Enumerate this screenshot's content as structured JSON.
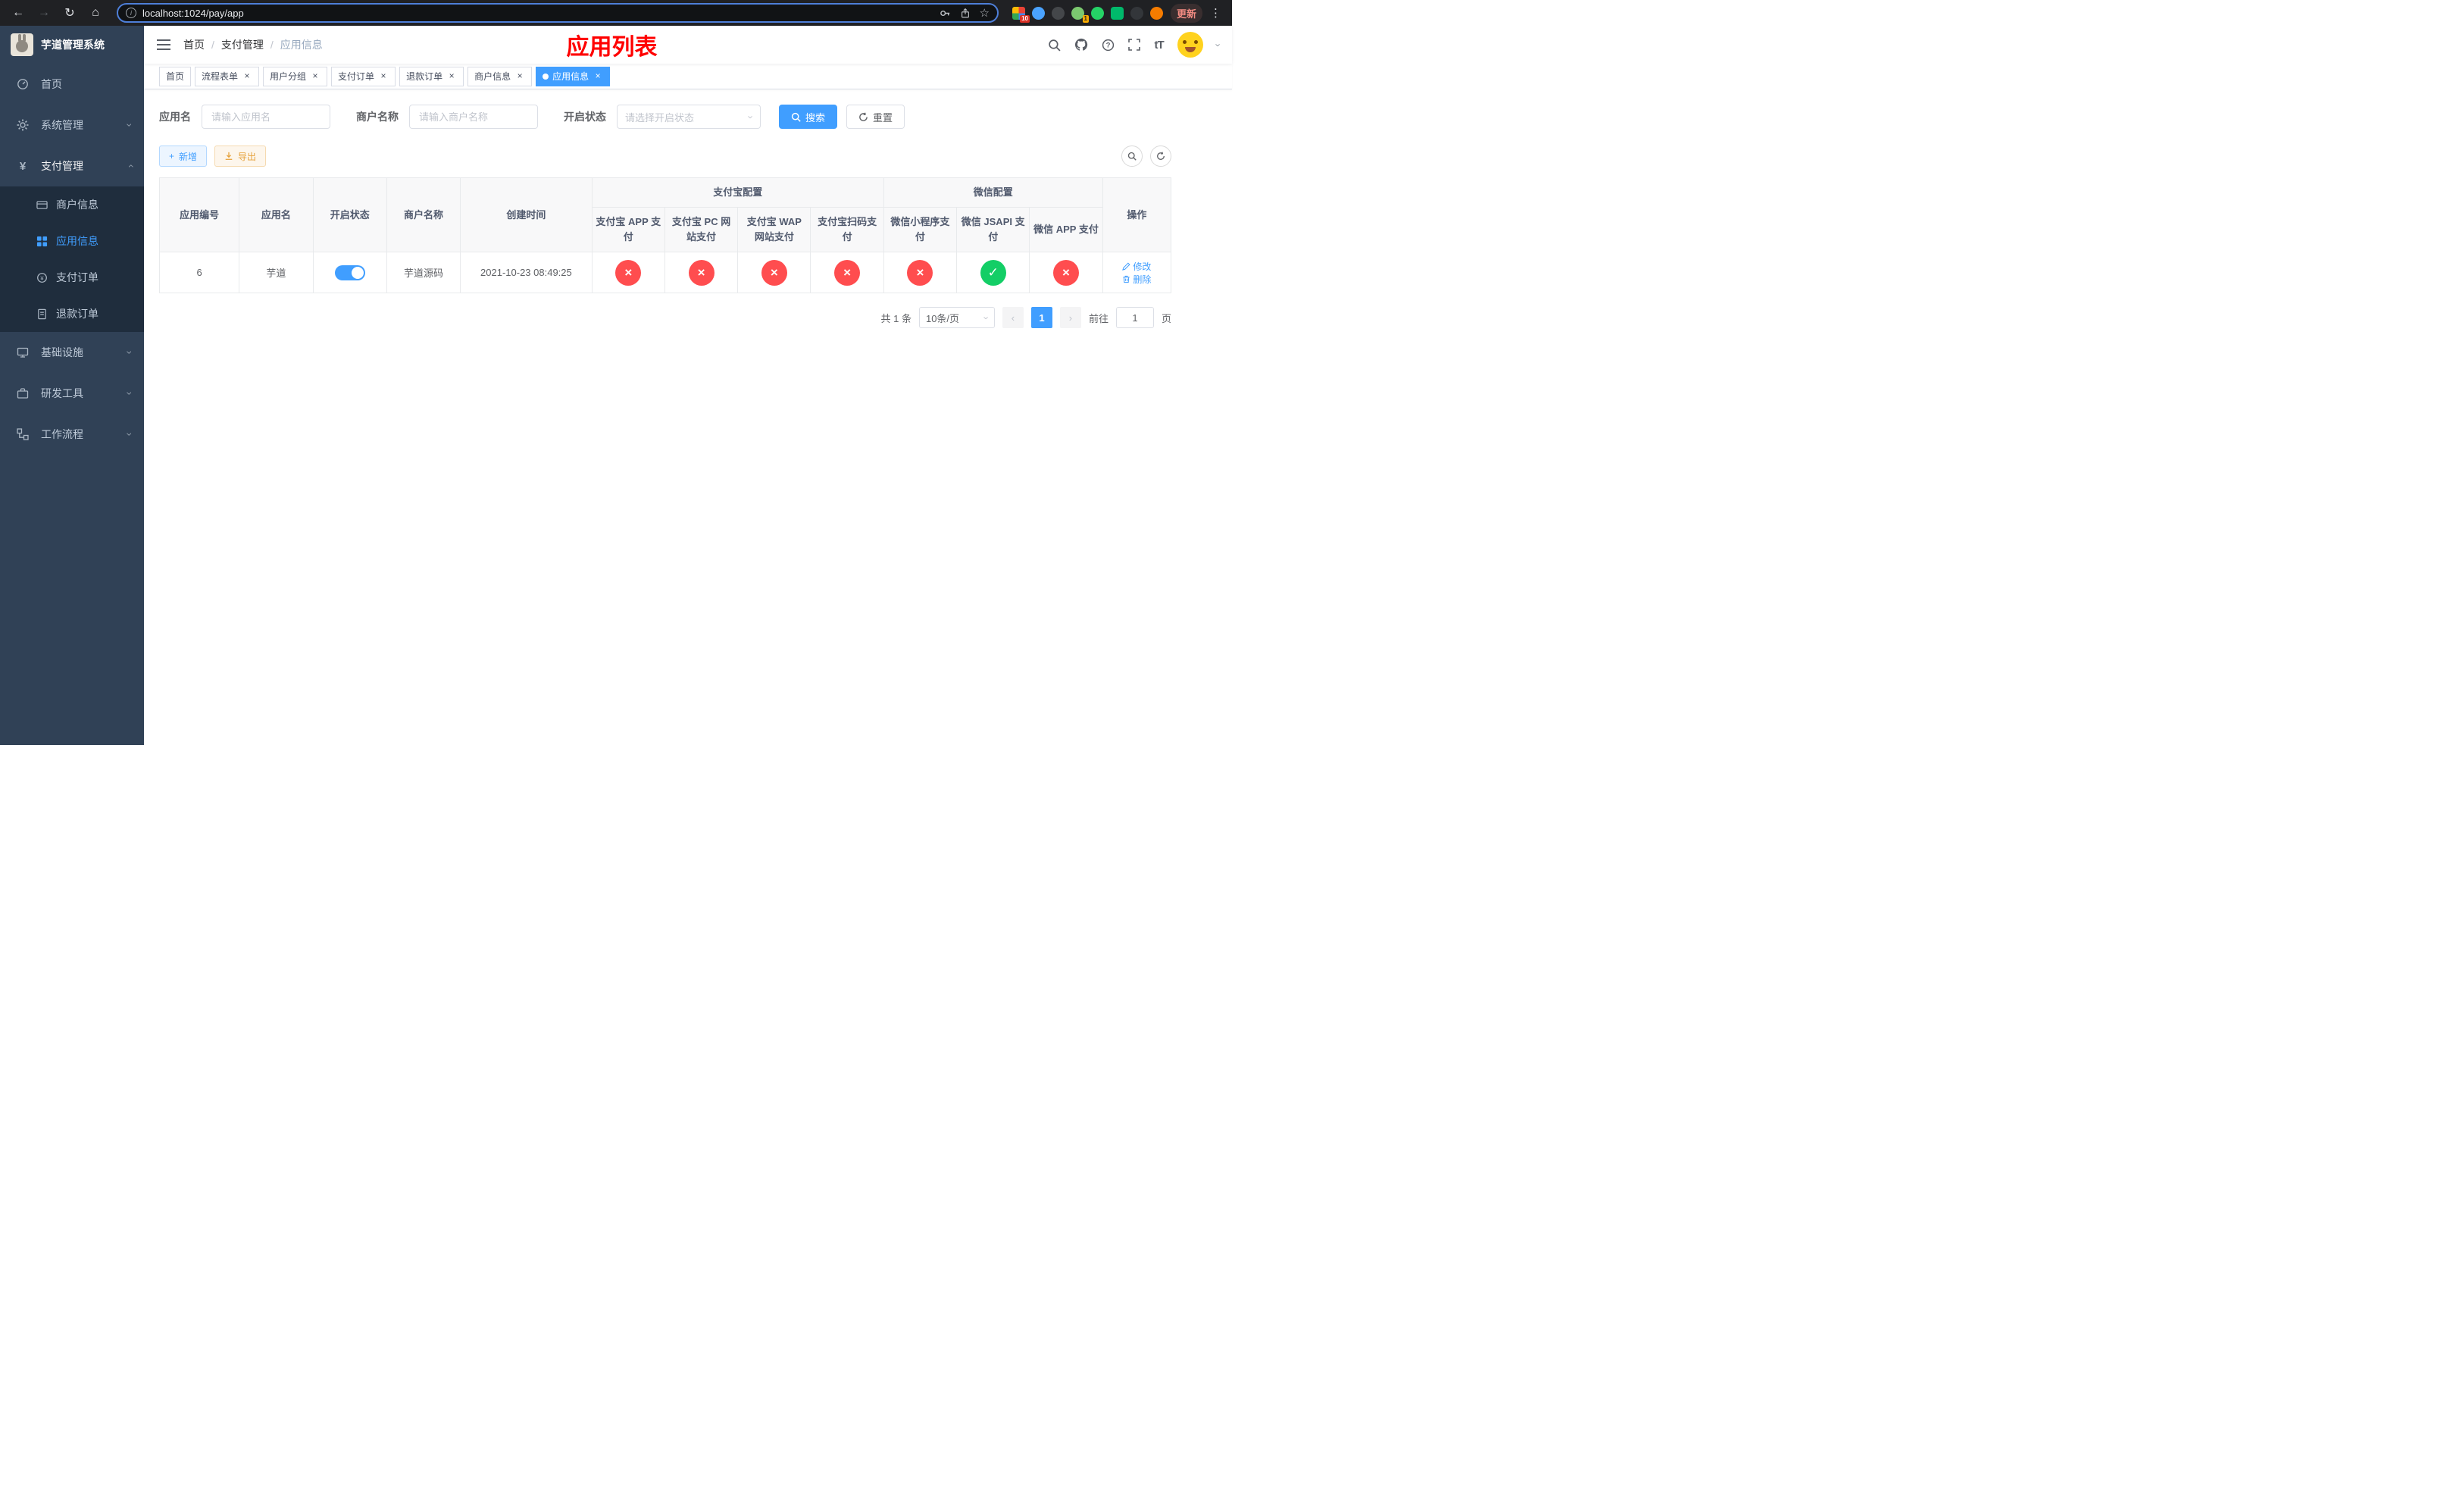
{
  "browser": {
    "url": "localhost:1024/pay/app",
    "update_label": "更新",
    "ext_badge_1": "10",
    "ext_badge_2": "1"
  },
  "icons": {
    "back": "←",
    "forward": "→",
    "reload": "↻",
    "home": "⌂",
    "star": "☆",
    "menu_dots": "⋮",
    "info": "i",
    "check": "✓",
    "cross": "×",
    "chevron": "›",
    "prev": "‹",
    "next": "›",
    "plus": "+",
    "close": "×"
  },
  "colors": {
    "accent": "#409eff",
    "success": "#13ce66",
    "danger": "#ff4d4f",
    "warning": "#e6a23c",
    "title": "#ff0000",
    "sidebar_bg": "#304156",
    "submenu_bg": "#1f2d3d"
  },
  "sidebar": {
    "title": "芋道管理系统",
    "items": [
      {
        "label": "首页"
      },
      {
        "label": "系统管理"
      },
      {
        "label": "支付管理"
      },
      {
        "label": "基础设施"
      },
      {
        "label": "研发工具"
      },
      {
        "label": "工作流程"
      }
    ],
    "submenu": [
      {
        "label": "商户信息"
      },
      {
        "label": "应用信息"
      },
      {
        "label": "支付订单"
      },
      {
        "label": "退款订单"
      }
    ]
  },
  "header": {
    "breadcrumb": [
      "首页",
      "支付管理",
      "应用信息"
    ],
    "title": "应用列表"
  },
  "tabs": [
    {
      "label": "首页"
    },
    {
      "label": "流程表单"
    },
    {
      "label": "用户分组"
    },
    {
      "label": "支付订单"
    },
    {
      "label": "退款订单"
    },
    {
      "label": "商户信息"
    },
    {
      "label": "应用信息"
    }
  ],
  "filters": {
    "app_name_label": "应用名",
    "app_name_placeholder": "请输入应用名",
    "merchant_label": "商户名称",
    "merchant_placeholder": "请输入商户名称",
    "status_label": "开启状态",
    "status_placeholder": "请选择开启状态",
    "search": "搜索",
    "reset": "重置"
  },
  "toolbar": {
    "add": "新增",
    "export": "导出"
  },
  "table": {
    "groups": {
      "alipay": "支付宝配置",
      "wechat": "微信配置"
    },
    "columns": [
      "应用编号",
      "应用名",
      "开启状态",
      "商户名称",
      "创建时间",
      "支付宝 APP 支付",
      "支付宝 PC 网站支付",
      "支付宝 WAP 网站支付",
      "支付宝扫码支付",
      "微信小程序支付",
      "微信 JSAPI 支付",
      "微信 APP 支付",
      "操作"
    ],
    "row": {
      "id": "6",
      "name": "芋道",
      "enabled": true,
      "merchant": "芋道源码",
      "created": "2021-10-23 08:49:25",
      "configs": [
        false,
        false,
        false,
        false,
        false,
        true,
        false
      ],
      "edit": "修改",
      "delete": "删除"
    }
  },
  "pagination": {
    "total": "共 1 条",
    "page_size": "10条/页",
    "page": "1",
    "goto": "前往",
    "goto_value": "1",
    "unit": "页"
  }
}
